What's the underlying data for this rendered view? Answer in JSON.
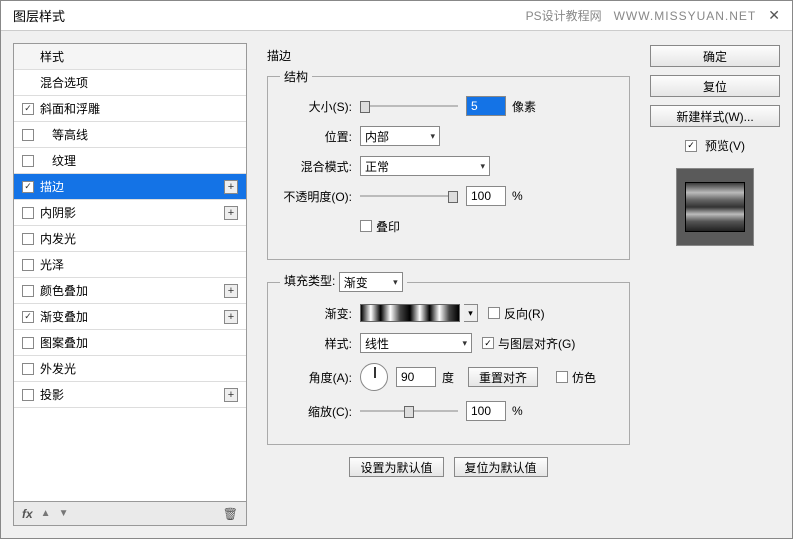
{
  "title": "图层样式",
  "watermark_label": "PS设计教程网",
  "watermark_url": "WWW.MISSYUAN.NET",
  "styles": {
    "header": "样式",
    "blending": "混合选项",
    "items": [
      {
        "label": "斜面和浮雕",
        "checked": true,
        "plus": false,
        "indent": false
      },
      {
        "label": "等高线",
        "checked": false,
        "plus": false,
        "indent": true
      },
      {
        "label": "纹理",
        "checked": false,
        "plus": false,
        "indent": true
      },
      {
        "label": "描边",
        "checked": true,
        "plus": true,
        "indent": false,
        "selected": true
      },
      {
        "label": "内阴影",
        "checked": false,
        "plus": true,
        "indent": false
      },
      {
        "label": "内发光",
        "checked": false,
        "plus": false,
        "indent": false
      },
      {
        "label": "光泽",
        "checked": false,
        "plus": false,
        "indent": false
      },
      {
        "label": "颜色叠加",
        "checked": false,
        "plus": true,
        "indent": false
      },
      {
        "label": "渐变叠加",
        "checked": true,
        "plus": true,
        "indent": false
      },
      {
        "label": "图案叠加",
        "checked": false,
        "plus": false,
        "indent": false
      },
      {
        "label": "外发光",
        "checked": false,
        "plus": false,
        "indent": false
      },
      {
        "label": "投影",
        "checked": false,
        "plus": true,
        "indent": false
      }
    ],
    "fx": "fx"
  },
  "stroke": {
    "section_title": "描边",
    "structure_title": "结构",
    "size_label": "大小(S):",
    "size_value": "5",
    "size_unit": "像素",
    "position_label": "位置:",
    "position_value": "内部",
    "blend_label": "混合模式:",
    "blend_value": "正常",
    "opacity_label": "不透明度(O):",
    "opacity_value": "100",
    "opacity_unit": "%",
    "overprint_label": "叠印",
    "fill_type_label": "填充类型:",
    "fill_type_value": "渐变",
    "gradient_label": "渐变:",
    "reverse_label": "反向(R)",
    "style_label": "样式:",
    "style_value": "线性",
    "align_label": "与图层对齐(G)",
    "angle_label": "角度(A):",
    "angle_value": "90",
    "angle_unit": "度",
    "reset_align": "重置对齐",
    "dither_label": "仿色",
    "scale_label": "缩放(C):",
    "scale_value": "100",
    "scale_unit": "%",
    "make_default": "设置为默认值",
    "reset_default": "复位为默认值"
  },
  "right": {
    "ok": "确定",
    "cancel": "复位",
    "new_style": "新建样式(W)...",
    "preview_label": "预览(V)"
  }
}
